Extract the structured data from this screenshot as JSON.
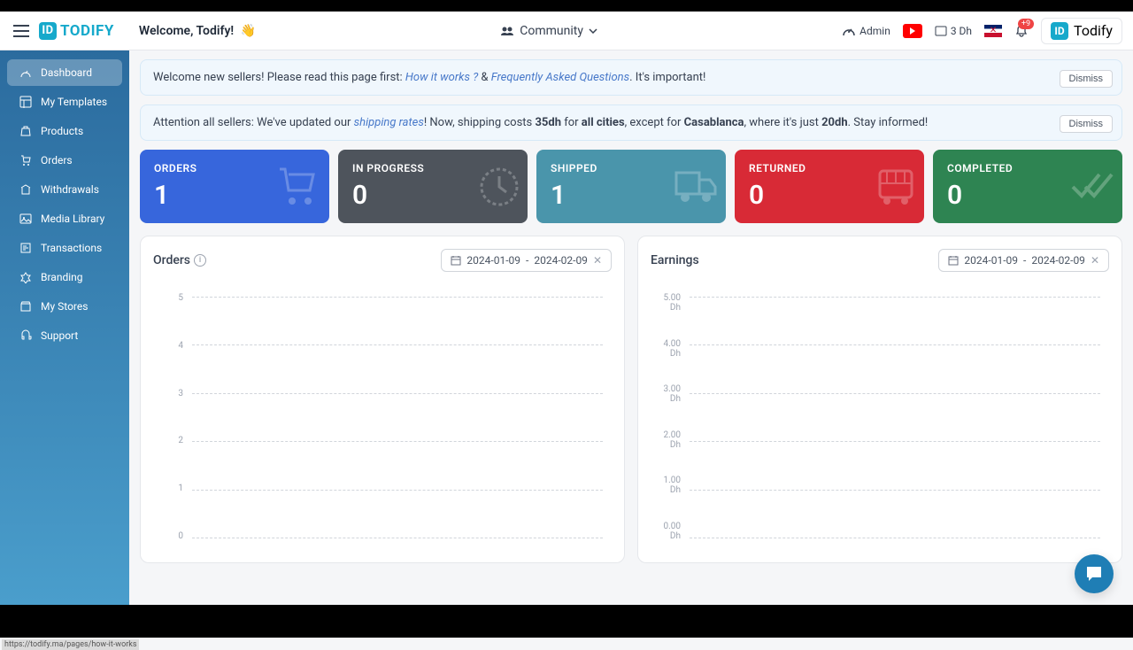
{
  "header": {
    "brand": "TODIFY",
    "welcome": "Welcome, Todify!",
    "wave_emoji": "👋",
    "community": "Community",
    "admin": "Admin",
    "balance": "3 Dh",
    "notifications": "+9",
    "user_name": "Todify"
  },
  "sidebar": {
    "items": [
      {
        "label": "Dashboard",
        "icon": "dashboard-icon"
      },
      {
        "label": "My Templates",
        "icon": "templates-icon"
      },
      {
        "label": "Products",
        "icon": "products-icon"
      },
      {
        "label": "Orders",
        "icon": "orders-icon"
      },
      {
        "label": "Withdrawals",
        "icon": "withdrawals-icon"
      },
      {
        "label": "Media Library",
        "icon": "media-icon"
      },
      {
        "label": "Transactions",
        "icon": "transactions-icon"
      },
      {
        "label": "Branding",
        "icon": "branding-icon"
      },
      {
        "label": "My Stores",
        "icon": "stores-icon"
      },
      {
        "label": "Support",
        "icon": "support-icon"
      }
    ]
  },
  "alerts": {
    "welcome_pre": "Welcome new sellers! Please read this page first: ",
    "how_it_works": "How it works ?",
    "amp": " & ",
    "faq": "Frequently Asked Questions",
    "welcome_post": ". It's important!",
    "attention_pre": "Attention all sellers: We've updated our ",
    "shipping_rates": "shipping rates",
    "attention_mid1": "! Now, shipping costs ",
    "rate_35": "35dh",
    "attention_mid2": " for ",
    "all_cities": "all cities",
    "attention_mid3": ", except for ",
    "casablanca": "Casablanca",
    "attention_mid4": ", where it's just ",
    "rate_20": "20dh",
    "attention_post": ". Stay informed!",
    "dismiss": "Dismiss"
  },
  "stats": [
    {
      "label": "ORDERS",
      "value": "1",
      "class": "stat-orders"
    },
    {
      "label": "IN PROGRESS",
      "value": "0",
      "class": "stat-progress"
    },
    {
      "label": "SHIPPED",
      "value": "1",
      "class": "stat-shipped"
    },
    {
      "label": "RETURNED",
      "value": "0",
      "class": "stat-returned"
    },
    {
      "label": "COMPLETED",
      "value": "0",
      "class": "stat-completed"
    }
  ],
  "charts": {
    "orders_title": "Orders",
    "earnings_title": "Earnings",
    "date_start": "2024-01-09",
    "date_sep": "-",
    "date_end": "2024-02-09"
  },
  "chart_data": [
    {
      "type": "line",
      "title": "Orders",
      "ylim": [
        0,
        5
      ],
      "y_ticks": [
        "5",
        "4",
        "3",
        "2",
        "1",
        "0"
      ],
      "series": [
        {
          "name": "Orders",
          "values": []
        }
      ]
    },
    {
      "type": "line",
      "title": "Earnings",
      "ylim": [
        0,
        5
      ],
      "y_ticks": [
        "5.00 Dh",
        "4.00 Dh",
        "3.00 Dh",
        "2.00 Dh",
        "1.00 Dh",
        "0.00 Dh"
      ],
      "series": [
        {
          "name": "Earnings",
          "values": []
        }
      ]
    }
  ],
  "status_hover": "https://todify.ma/pages/how-it-works"
}
